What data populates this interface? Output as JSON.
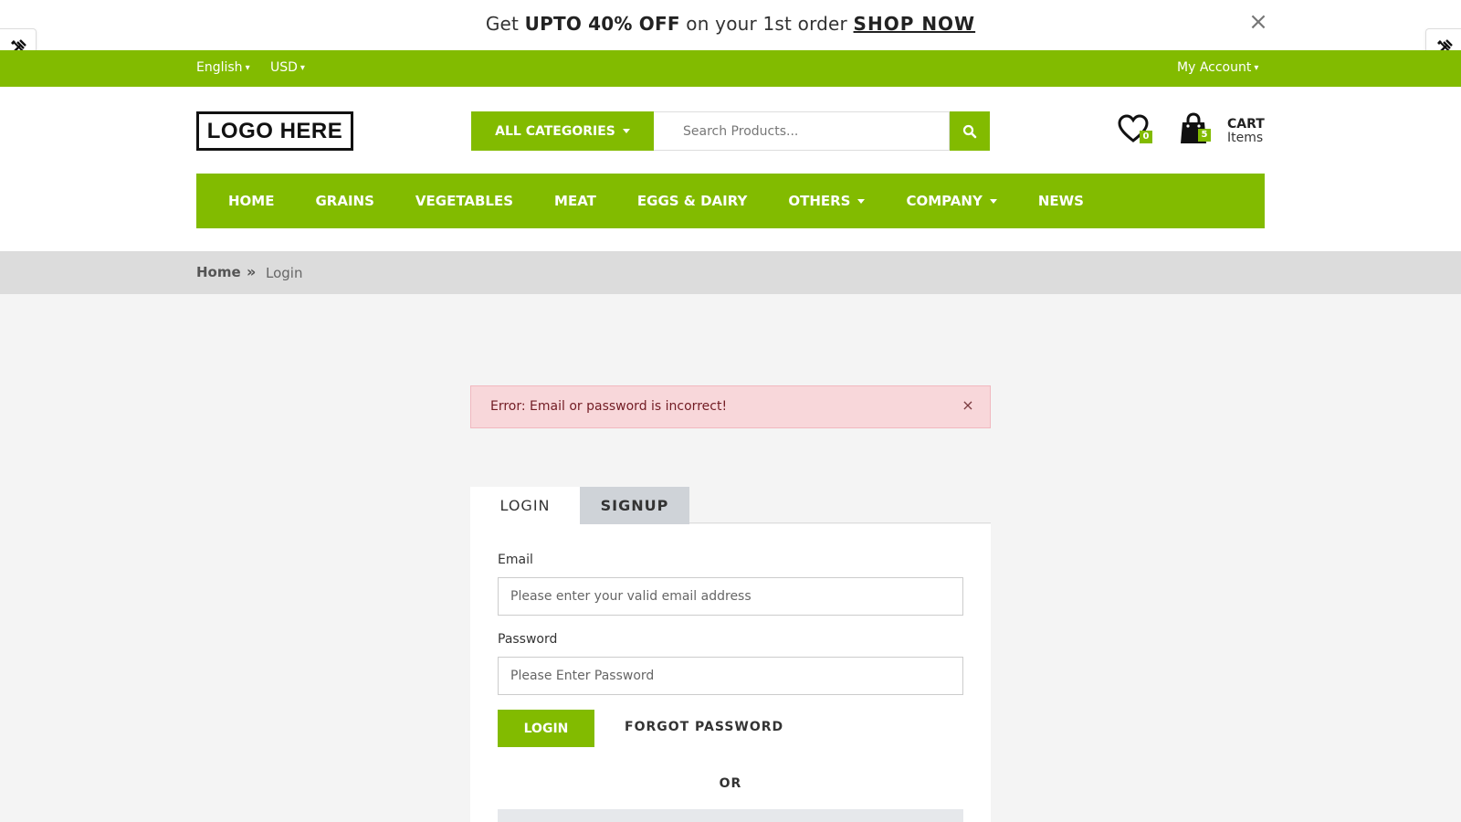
{
  "promo": {
    "text_get": "Get ",
    "text_bold": "UPTO 40% OFF",
    "text_mid": " on your 1st order ",
    "text_link": "SHOP NOW",
    "close": "×"
  },
  "topbar": {
    "language": "English",
    "currency": "USD",
    "account": "My Account"
  },
  "header": {
    "logo": "LOGO HERE",
    "categories_label": "ALL CATEGORIES",
    "search_placeholder": "Search Products...",
    "wishlist_count": "0",
    "cart_count": "5",
    "cart_label": "CART",
    "cart_sub": "Items"
  },
  "nav": {
    "items": [
      {
        "label": "HOME"
      },
      {
        "label": "GRAINS"
      },
      {
        "label": "VEGETABLES"
      },
      {
        "label": "MEAT"
      },
      {
        "label": "EGGS & DAIRY"
      },
      {
        "label": "OTHERS"
      },
      {
        "label": "COMPANY"
      },
      {
        "label": "NEWS"
      }
    ]
  },
  "breadcrumb": {
    "home": "Home",
    "separator": "»",
    "current": "Login"
  },
  "alert": {
    "message": "Error: Email or password is incorrect!",
    "close": "×"
  },
  "tabs": {
    "login": "LOGIN",
    "signup": "SIGNUP"
  },
  "form": {
    "email_label": "Email",
    "email_placeholder": "Please enter your valid email address",
    "password_label": "Password",
    "password_placeholder": "Please Enter Password",
    "login_button": "LOGIN",
    "forgot_password": "FORGOT PASSWORD",
    "or_text": "OR"
  },
  "colors": {
    "brand_green": "#82bb00",
    "alert_bg": "#f8d7da",
    "breadcrumb_bg": "#dcdcdc",
    "page_bg": "#f4f4f4"
  },
  "icons": {
    "tools": "tools-icon",
    "search": "search-icon",
    "wishlist": "heart-icon",
    "cart": "shopping-bag-icon",
    "close": "close-icon"
  }
}
